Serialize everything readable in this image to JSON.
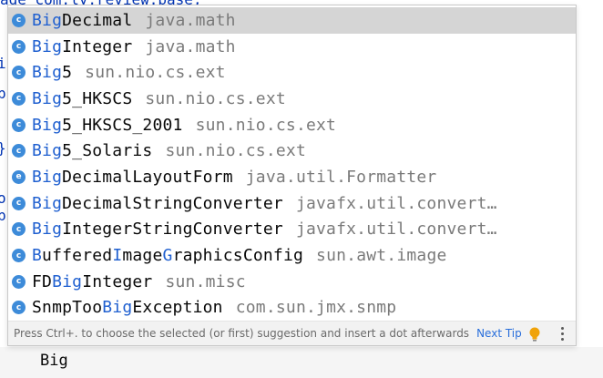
{
  "editor": {
    "top_code": "age com.ly.review.base;",
    "gutter_chars": [
      "i",
      "p",
      "}",
      "o",
      "b"
    ],
    "typed_text": "Big"
  },
  "completion": {
    "items": [
      {
        "kind": "c",
        "segments": [
          {
            "t": "Big",
            "m": true
          },
          {
            "t": "Decimal",
            "m": false
          }
        ],
        "package": "java.math",
        "selected": true
      },
      {
        "kind": "c",
        "segments": [
          {
            "t": "Big",
            "m": true
          },
          {
            "t": "Integer",
            "m": false
          }
        ],
        "package": "java.math"
      },
      {
        "kind": "c",
        "segments": [
          {
            "t": "Big",
            "m": true
          },
          {
            "t": "5",
            "m": false
          }
        ],
        "package": "sun.nio.cs.ext"
      },
      {
        "kind": "c",
        "segments": [
          {
            "t": "Big",
            "m": true
          },
          {
            "t": "5_HKSCS",
            "m": false
          }
        ],
        "package": "sun.nio.cs.ext"
      },
      {
        "kind": "c",
        "segments": [
          {
            "t": "Big",
            "m": true
          },
          {
            "t": "5_HKSCS_2001",
            "m": false
          }
        ],
        "package": "sun.nio.cs.ext"
      },
      {
        "kind": "c",
        "segments": [
          {
            "t": "Big",
            "m": true
          },
          {
            "t": "5_Solaris",
            "m": false
          }
        ],
        "package": "sun.nio.cs.ext"
      },
      {
        "kind": "e",
        "segments": [
          {
            "t": "Big",
            "m": true
          },
          {
            "t": "DecimalLayoutForm",
            "m": false
          }
        ],
        "package": "java.util.Formatter"
      },
      {
        "kind": "c",
        "segments": [
          {
            "t": "Big",
            "m": true
          },
          {
            "t": "DecimalStringConverter",
            "m": false
          }
        ],
        "package": "javafx.util.convert…"
      },
      {
        "kind": "c",
        "segments": [
          {
            "t": "Big",
            "m": true
          },
          {
            "t": "IntegerStringConverter",
            "m": false
          }
        ],
        "package": "javafx.util.convert…"
      },
      {
        "kind": "c",
        "segments": [
          {
            "t": "B",
            "m": true
          },
          {
            "t": "uffered",
            "m": false
          },
          {
            "t": "I",
            "m": true
          },
          {
            "t": "mage",
            "m": false
          },
          {
            "t": "G",
            "m": true
          },
          {
            "t": "raphicsConfig",
            "m": false
          }
        ],
        "package": "sun.awt.image"
      },
      {
        "kind": "c",
        "segments": [
          {
            "t": "FD",
            "m": false
          },
          {
            "t": "Big",
            "m": true
          },
          {
            "t": "Integer",
            "m": false
          }
        ],
        "package": "sun.misc"
      },
      {
        "kind": "c",
        "segments": [
          {
            "t": "SnmpToo",
            "m": false
          },
          {
            "t": "Big",
            "m": true
          },
          {
            "t": "Exception",
            "m": false
          }
        ],
        "package": "com.sun.jmx.snmp"
      }
    ],
    "footer": {
      "tip": "Press Ctrl+. to choose the selected (or first) suggestion and insert a dot afterwards",
      "next_tip": "Next Tip"
    },
    "icons": {
      "bulb": "lightbulb-icon",
      "more": "more-vertical-icon"
    },
    "colors": {
      "match": "#2060d0",
      "icon": "#3d8bd9",
      "selected_bg": "#d5d5d5",
      "bulb": "#f0a30a"
    }
  }
}
